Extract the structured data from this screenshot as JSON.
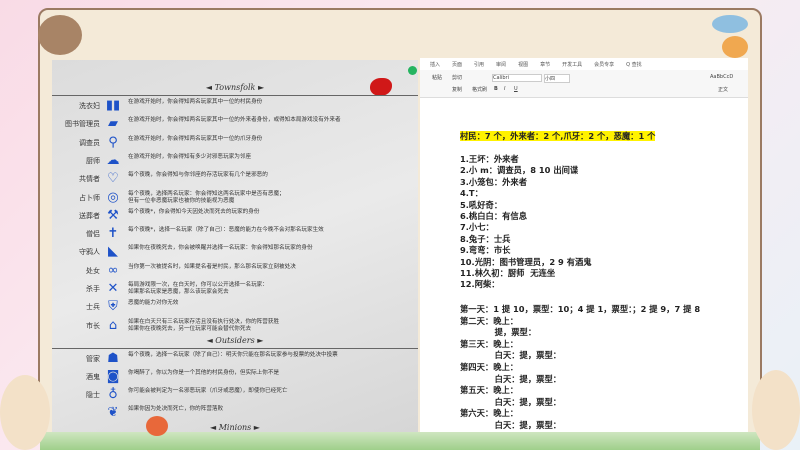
{
  "word": {
    "tabs": [
      "插入",
      "页面",
      "引用",
      "审阅",
      "视图",
      "章节",
      "开发工具",
      "会员专享",
      "Q 查找"
    ],
    "toolbar": {
      "paste": "粘贴",
      "cut": "剪切",
      "copy": "复制",
      "format_painter": "格式刷",
      "font": "Calibri",
      "size": "小四",
      "style_preview": "AaBbCcD",
      "style_name": "正文",
      "bold": "B",
      "italic": "I",
      "underline": "U"
    }
  },
  "script": {
    "townsfolk_title": "◄ Townsfolk ►",
    "townsfolk": [
      {
        "name": "洗衣妇",
        "icon": "laundry-icon",
        "text": "在游戏开始时，你会得知两名玩家其中一位的村民身份"
      },
      {
        "name": "图书管理员",
        "icon": "book-icon",
        "text": "在游戏开始时，你会得知两名玩家其中一位的外来者身份，或得知本局游戏没有外来者"
      },
      {
        "name": "调查员",
        "icon": "magnifier-icon",
        "text": "在游戏开始时，你会得知两名玩家其中一位的爪牙身份"
      },
      {
        "name": "厨师",
        "icon": "chef-hat-icon",
        "text": "在游戏开始时，你会得知有多少对邪恶玩家为邻座"
      },
      {
        "name": "共情者",
        "icon": "heart-icon",
        "text": "每个夜晚，你会得知与你邻座的存活玩家有几个是邪恶的"
      },
      {
        "name": "占卜师",
        "icon": "crystal-ball-icon",
        "text": "每个夜晚，选择两名玩家：你会得知这两名玩家中是否有恶魔；\n但有一位非恶魔玩家也被你的技能视为恶魔"
      },
      {
        "name": "送葬者",
        "icon": "shovel-icon",
        "text": "每个夜晚*，你会得知今天因处决而死去的玩家的身份"
      },
      {
        "name": "僧侣",
        "icon": "cross-icon",
        "text": "每个夜晚*，选择一名玩家（除了自己）：恶魔的能力在今晚不会对那名玩家生效"
      },
      {
        "name": "守鸦人",
        "icon": "raven-icon",
        "text": "如果你在夜晚死去，你会被唤醒并选择一名玩家：你会得知那名玩家的身份"
      },
      {
        "name": "处女",
        "icon": "rings-icon",
        "text": "当你第一次被提名时，如果提名者是村民，那么那名玩家立刻被处决"
      },
      {
        "name": "杀手",
        "icon": "crossbow-icon",
        "text": "每局游戏限一次，在白天时，你可以公开选择一名玩家：\n如果那名玩家是恶魔，那么该玩家会死去"
      },
      {
        "name": "士兵",
        "icon": "shield-icon",
        "text": "恶魔的能力对你无效"
      },
      {
        "name": "市长",
        "icon": "town-hall-icon",
        "text": "如果在白天只有三名玩家存活且没有执行处决，你的阵营获胜\n如果你在夜晚死去，另一位玩家可能会替代你死去"
      }
    ],
    "outsiders_title": "◄ Outsiders ►",
    "outsiders": [
      {
        "name": "管家",
        "icon": "butler-icon",
        "text": "每个夜晚，选择一名玩家（除了自己）：明天你只能在那名玩家参与投票的处决中投票"
      },
      {
        "name": "酒鬼",
        "icon": "beer-mug-icon",
        "text": "你喝醉了，你以为你是一个其他的村民身份，但实际上你不是"
      },
      {
        "name": "隐士",
        "icon": "lantern-icon",
        "text": "你可能会被判定为一名邪恶玩家（爪牙或恶魔），即使你已经死亡"
      },
      {
        "name": "",
        "icon": "saint-icon",
        "text": "如果你因为处决而死亡，你的阵营落败"
      }
    ],
    "minions_title": "◄ Minions ►"
  },
  "notes": {
    "summary": "村民：7 个，外来者：2 个,爪牙：2 个，恶魔：1 个",
    "players": [
      "1.王坏：外来者",
      "2.小 m：调查员，8 10 出间谍",
      "3.小笼包：外来者",
      "4.T：",
      "5.吼好奇：",
      "6.桃白白：有信息",
      "7.小七：",
      "8.兔子：士兵",
      "9.弯弯：市长",
      "10.光阴：图书管理员，2 9 有酒鬼",
      "11.林久初：厨师  无连坐",
      "12.阿柴："
    ],
    "days": [
      "第一天：1 提 10，票型：10；4 提 1，票型：；2 提 9，7 提 8",
      "第二天：晚上：",
      "            提，票型：",
      "第三天：晚上：",
      "            白天：提，票型：",
      "第四天：晚上：",
      "            白天：提，票型：",
      "第五天：晚上：",
      "            白天：提，票型：",
      "第六天：晚上：",
      "            白天：提，票型："
    ]
  }
}
